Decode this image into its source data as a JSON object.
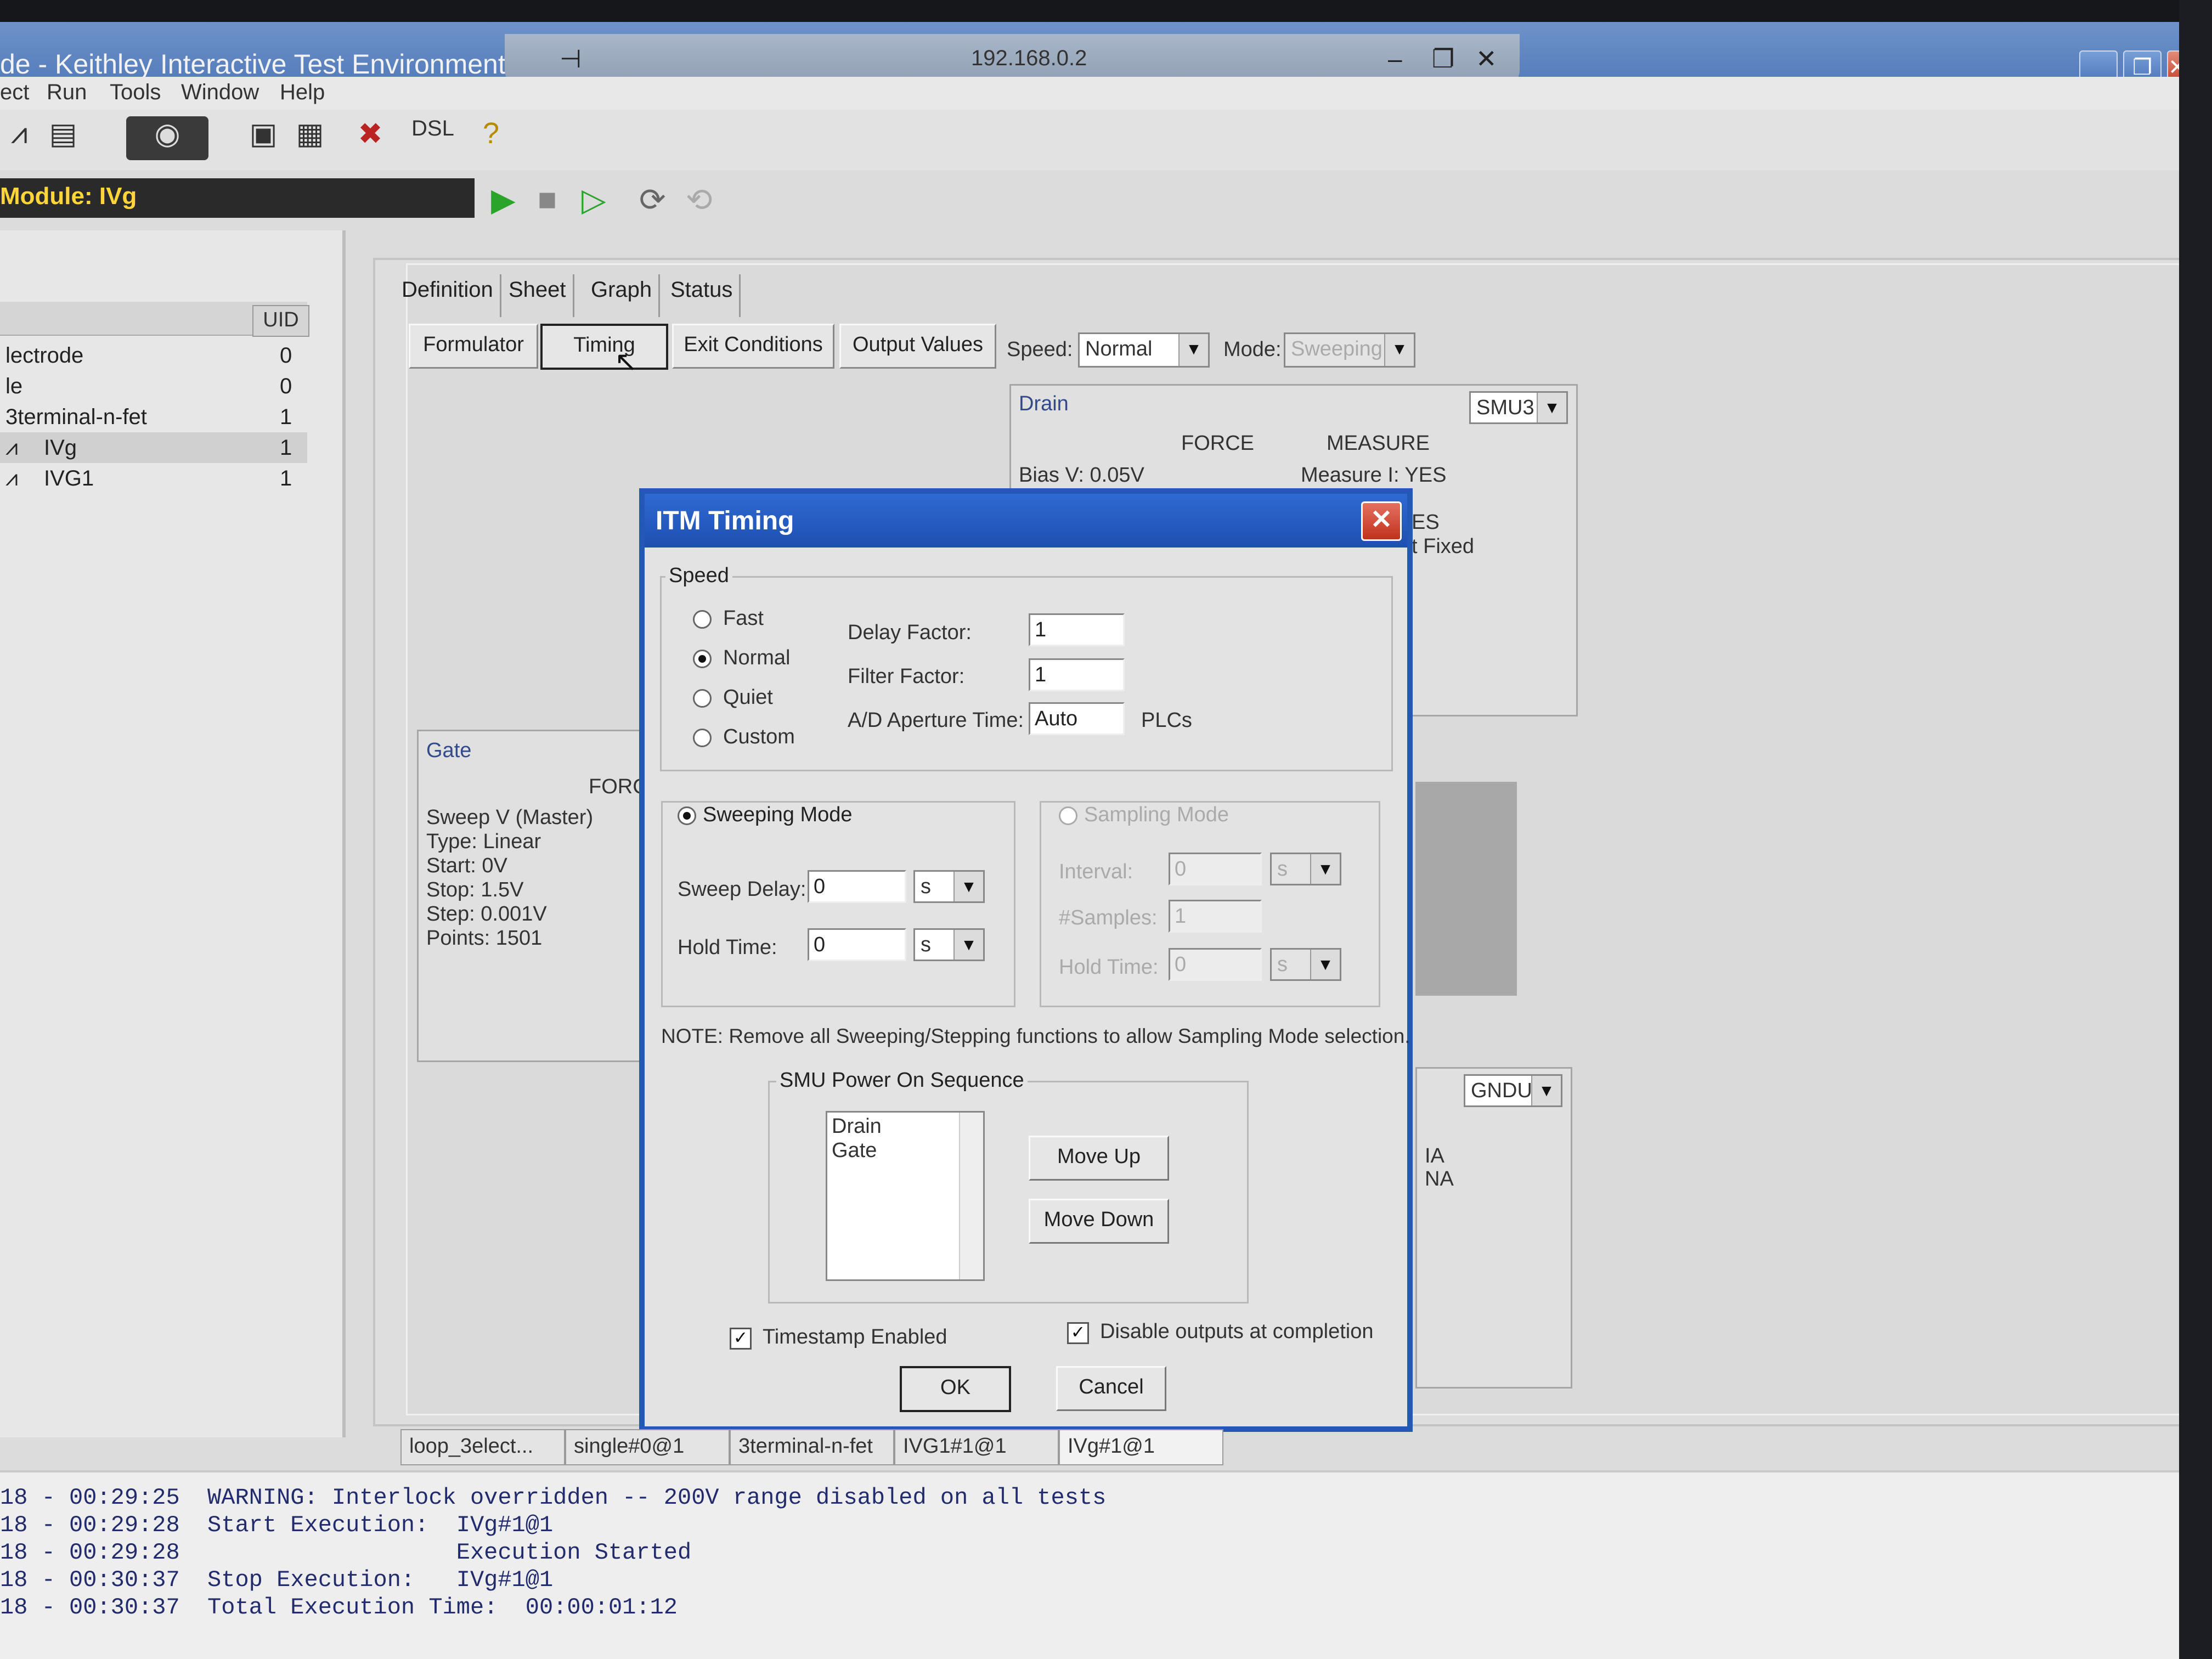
{
  "window": {
    "title": "de - Keithley Interactive Test Environment",
    "remote_host": "192.168.0.2"
  },
  "menu": [
    "ect",
    "Run",
    "Tools",
    "Window",
    "Help"
  ],
  "module_label": "Module: IVg",
  "left_pane": {
    "uid_header": "UID",
    "rows": [
      {
        "name": "lectrode",
        "uid": "0"
      },
      {
        "name": "le",
        "uid": "0"
      },
      {
        "name": "3terminal-n-fet",
        "uid": "1"
      },
      {
        "name": "IVg",
        "uid": "1"
      },
      {
        "name": "IVG1",
        "uid": "1"
      }
    ]
  },
  "tabs": [
    "Definition",
    "Sheet",
    "Graph",
    "Status"
  ],
  "subbuttons": [
    "Formulator",
    "Timing",
    "Exit Conditions",
    "Output Values"
  ],
  "speed": {
    "label": "Speed:",
    "value": "Normal"
  },
  "mode": {
    "label": "Mode:",
    "value": "Sweeping"
  },
  "drain_panel": {
    "title": "Drain",
    "smu": "SMU3",
    "force_header": "FORCE",
    "measure_header": "MEASURE",
    "force": "Bias V: 0.05V",
    "measure": [
      "Measure I: YES",
      "ES",
      "t Fixed"
    ]
  },
  "gate_panel": {
    "title": "Gate",
    "force_header": "FORC",
    "lines": [
      "Sweep V (Master)",
      "Type: Linear",
      "Start: 0V",
      "Stop: 1.5V",
      "Step: 0.001V",
      "Points: 1501"
    ]
  },
  "gndu_panel": {
    "smu": "GNDU",
    "lines": [
      "IA",
      "NA"
    ]
  },
  "dialog": {
    "title": "ITM Timing",
    "speed_group": "Speed",
    "speed_options": [
      "Fast",
      "Normal",
      "Quiet",
      "Custom"
    ],
    "selected_speed": "Normal",
    "delay_factor_label": "Delay Factor:",
    "delay_factor": "1",
    "filter_factor_label": "Filter Factor:",
    "filter_factor": "1",
    "aperture_label": "A/D Aperture Time:",
    "aperture": "Auto",
    "aperture_unit": "PLCs",
    "sweeping_mode": "Sweeping Mode",
    "sweep_delay_label": "Sweep Delay:",
    "sweep_delay": "0",
    "sweep_delay_unit": "s",
    "hold_time_label": "Hold Time:",
    "hold_time": "0",
    "hold_time_unit": "s",
    "sampling_mode": "Sampling Mode",
    "interval_label": "Interval:",
    "interval": "0",
    "interval_unit": "s",
    "samples_label": "#Samples:",
    "samples": "1",
    "s_hold_time_label": "Hold Time:",
    "s_hold_time": "0",
    "s_hold_unit": "s",
    "note": "NOTE: Remove all Sweeping/Stepping functions to allow Sampling Mode selection.",
    "power_group": "SMU Power On Sequence",
    "power_list": [
      "Drain",
      "Gate"
    ],
    "move_up": "Move Up",
    "move_down": "Move Down",
    "timestamp_label": "Timestamp Enabled",
    "disable_outputs_label": "Disable outputs at completion",
    "ok": "OK",
    "cancel": "Cancel"
  },
  "bottom_tabs": [
    "loop_3elect...",
    "single#0@1",
    "3terminal-n-fet",
    "IVG1#1@1",
    "IVg#1@1"
  ],
  "log": [
    "18 - 00:29:25  WARNING: Interlock overridden -- 200V range disabled on all tests",
    "18 - 00:29:28  Start Execution:  IVg#1@1",
    "18 - 00:29:28                    Execution Started",
    "18 - 00:30:37  Stop Execution:   IVg#1@1",
    "18 - 00:30:37  Total Execution Time:  00:00:01:12"
  ]
}
